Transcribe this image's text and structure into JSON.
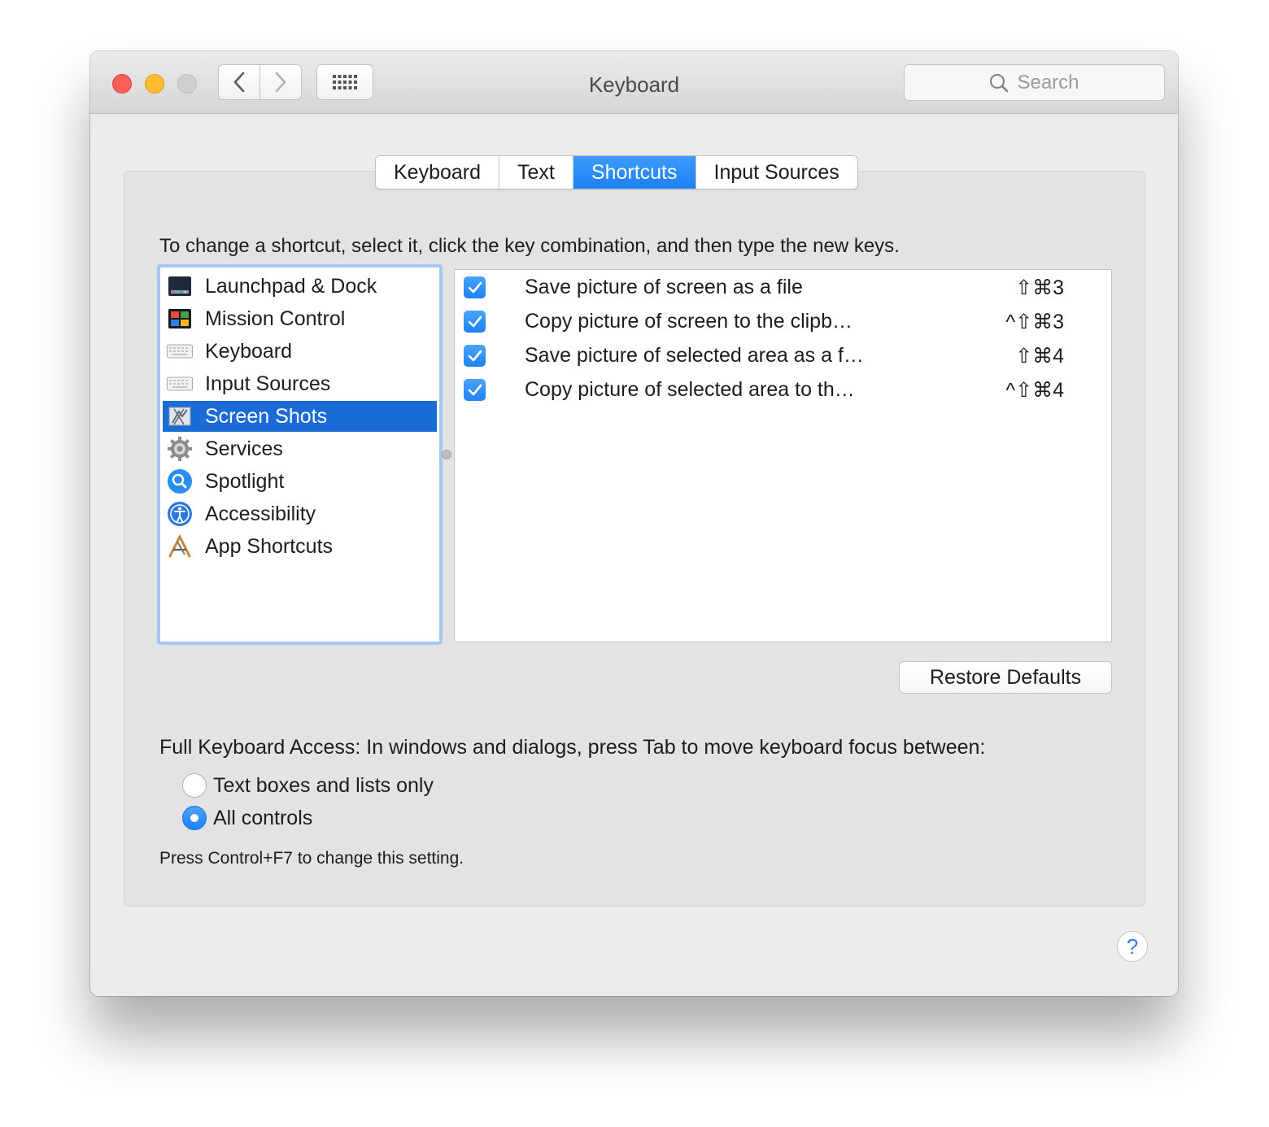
{
  "window": {
    "title": "Keyboard"
  },
  "toolbar": {
    "back_icon": "chevron-left-icon",
    "forward_icon": "chevron-right-icon",
    "grid_icon": "grid-icon",
    "search_placeholder": "Search"
  },
  "tabs": [
    {
      "label": "Keyboard",
      "active": false
    },
    {
      "label": "Text",
      "active": false
    },
    {
      "label": "Shortcuts",
      "active": true
    },
    {
      "label": "Input Sources",
      "active": false
    }
  ],
  "instruction": "To change a shortcut, select it, click the key combination, and then type the new keys.",
  "categories": [
    {
      "label": "Launchpad & Dock",
      "icon": "launchpad-dock-icon",
      "selected": false
    },
    {
      "label": "Mission Control",
      "icon": "mission-control-icon",
      "selected": false
    },
    {
      "label": "Keyboard",
      "icon": "keyboard-icon",
      "selected": false
    },
    {
      "label": "Input Sources",
      "icon": "keyboard-icon",
      "selected": false
    },
    {
      "label": "Screen Shots",
      "icon": "screenshot-icon",
      "selected": true
    },
    {
      "label": "Services",
      "icon": "gear-icon",
      "selected": false
    },
    {
      "label": "Spotlight",
      "icon": "spotlight-icon",
      "selected": false
    },
    {
      "label": "Accessibility",
      "icon": "accessibility-icon",
      "selected": false
    },
    {
      "label": "App Shortcuts",
      "icon": "app-shortcuts-icon",
      "selected": false
    }
  ],
  "shortcuts": [
    {
      "checked": true,
      "label": "Save picture of screen as a file",
      "keys": "⇧⌘3"
    },
    {
      "checked": true,
      "label": "Copy picture of screen to the clipb…",
      "keys": "^⇧⌘3"
    },
    {
      "checked": true,
      "label": "Save picture of selected area as a f…",
      "keys": "⇧⌘4"
    },
    {
      "checked": true,
      "label": "Copy picture of selected area to th…",
      "keys": "^⇧⌘4"
    }
  ],
  "restore_defaults_label": "Restore Defaults",
  "full_keyboard_access": {
    "label": "Full Keyboard Access: In windows and dialogs, press Tab to move keyboard focus between:",
    "options": [
      {
        "label": "Text boxes and lists only",
        "selected": false
      },
      {
        "label": "All controls",
        "selected": true
      }
    ],
    "hint": "Press Control+F7 to change this setting."
  },
  "help_label": "?",
  "colors": {
    "accent": "#1f82f5",
    "selection": "#1a6bd5",
    "close": "#fc5f57",
    "minimize": "#fdbc2e"
  }
}
